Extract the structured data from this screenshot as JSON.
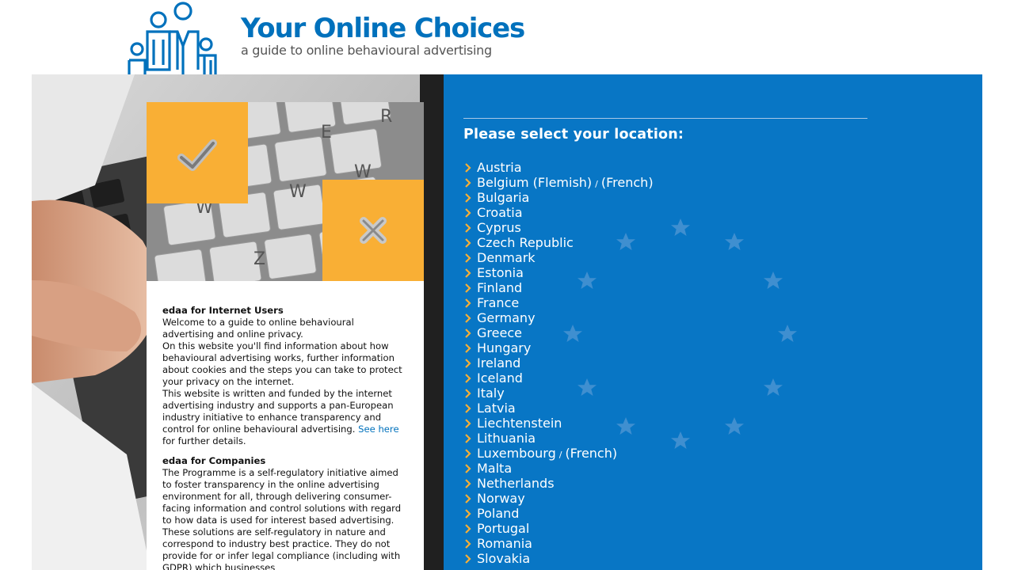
{
  "brand": {
    "title": "Your Online Choices",
    "tagline": "a guide to online behavioural advertising"
  },
  "card": {
    "users": {
      "heading": "edaa for Internet Users",
      "p1": "Welcome to a guide to online behavioural advertising and online privacy.",
      "p2": "On this website you'll find information about how behavioural advertising works, further information about cookies and the steps you can take to protect your privacy on the internet.",
      "p3_before": "This website is written and funded by the internet advertising industry and supports a pan-European industry initiative to enhance transparency and control for online behavioural advertising.",
      "p3_link": "See here",
      "p3_after": "for further details."
    },
    "companies": {
      "heading": "edaa for Companies",
      "p1": "The Programme is a self-regulatory initiative aimed to foster transparency in the online advertising environment for all, through delivering consumer-facing information and control solutions with regard to how data is used for interest based advertising. These solutions are self-regulatory in nature and correspond to industry best practice. They do not provide for or infer legal compliance (including with GDPR) which businesses"
    }
  },
  "location": {
    "title": "Please select your location:",
    "countries": [
      {
        "name": "Austria"
      },
      {
        "name": "Belgium (Flemish)",
        "alt": "(French)"
      },
      {
        "name": "Bulgaria"
      },
      {
        "name": "Croatia"
      },
      {
        "name": "Cyprus"
      },
      {
        "name": "Czech Republic"
      },
      {
        "name": "Denmark"
      },
      {
        "name": "Estonia"
      },
      {
        "name": "Finland"
      },
      {
        "name": "France"
      },
      {
        "name": "Germany"
      },
      {
        "name": "Greece"
      },
      {
        "name": "Hungary"
      },
      {
        "name": "Ireland"
      },
      {
        "name": "Iceland"
      },
      {
        "name": "Italy"
      },
      {
        "name": "Latvia"
      },
      {
        "name": "Liechtenstein"
      },
      {
        "name": "Lithuania"
      },
      {
        "name": "Luxembourg",
        "alt": "(French)"
      },
      {
        "name": "Malta"
      },
      {
        "name": "Netherlands"
      },
      {
        "name": "Norway"
      },
      {
        "name": "Poland"
      },
      {
        "name": "Portugal"
      },
      {
        "name": "Romania"
      },
      {
        "name": "Slovakia"
      }
    ],
    "separator": "/"
  },
  "colors": {
    "brand_blue": "#0071bc",
    "panel_blue": "#0876c5",
    "accent_orange": "#f9af35"
  }
}
